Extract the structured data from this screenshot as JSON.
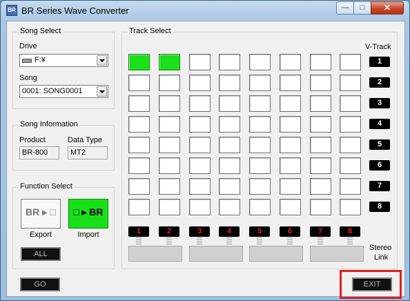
{
  "window": {
    "title": "BR Series Wave Converter",
    "app_icon": "BR",
    "min_label": "—",
    "max_label": "□",
    "close_label": "✕"
  },
  "song_select": {
    "label": "Song Select",
    "drive_label": "Drive",
    "drive_value": "F:¥",
    "song_label": "Song",
    "song_value": "0001: SONG0001"
  },
  "song_information": {
    "label": "Song Information",
    "product_label": "Product",
    "product_value": "BR-800",
    "data_type_label": "Data Type",
    "data_type_value": "MT2"
  },
  "function_select": {
    "label": "Function Select",
    "export_icon": "BR ▸ □",
    "export_label": "Export",
    "import_icon": "□ ▸ BR",
    "import_label": "Import",
    "all_label": "ALL"
  },
  "track_select": {
    "label": "Track Select",
    "vtrack_label": "V-Track",
    "stereo_label": "Stereo",
    "link_label": "Link",
    "vtracks": [
      "1",
      "2",
      "3",
      "4",
      "5",
      "6",
      "7",
      "8"
    ],
    "tracks": [
      "1",
      "2",
      "3",
      "4",
      "5",
      "6",
      "7",
      "8"
    ],
    "selected": [
      [
        0,
        0
      ],
      [
        0,
        1
      ]
    ]
  },
  "buttons": {
    "go_label": "GO",
    "exit_label": "EXIT"
  },
  "colors": {
    "selected_cell": "#19e019",
    "highlight": "#e01e1e"
  }
}
